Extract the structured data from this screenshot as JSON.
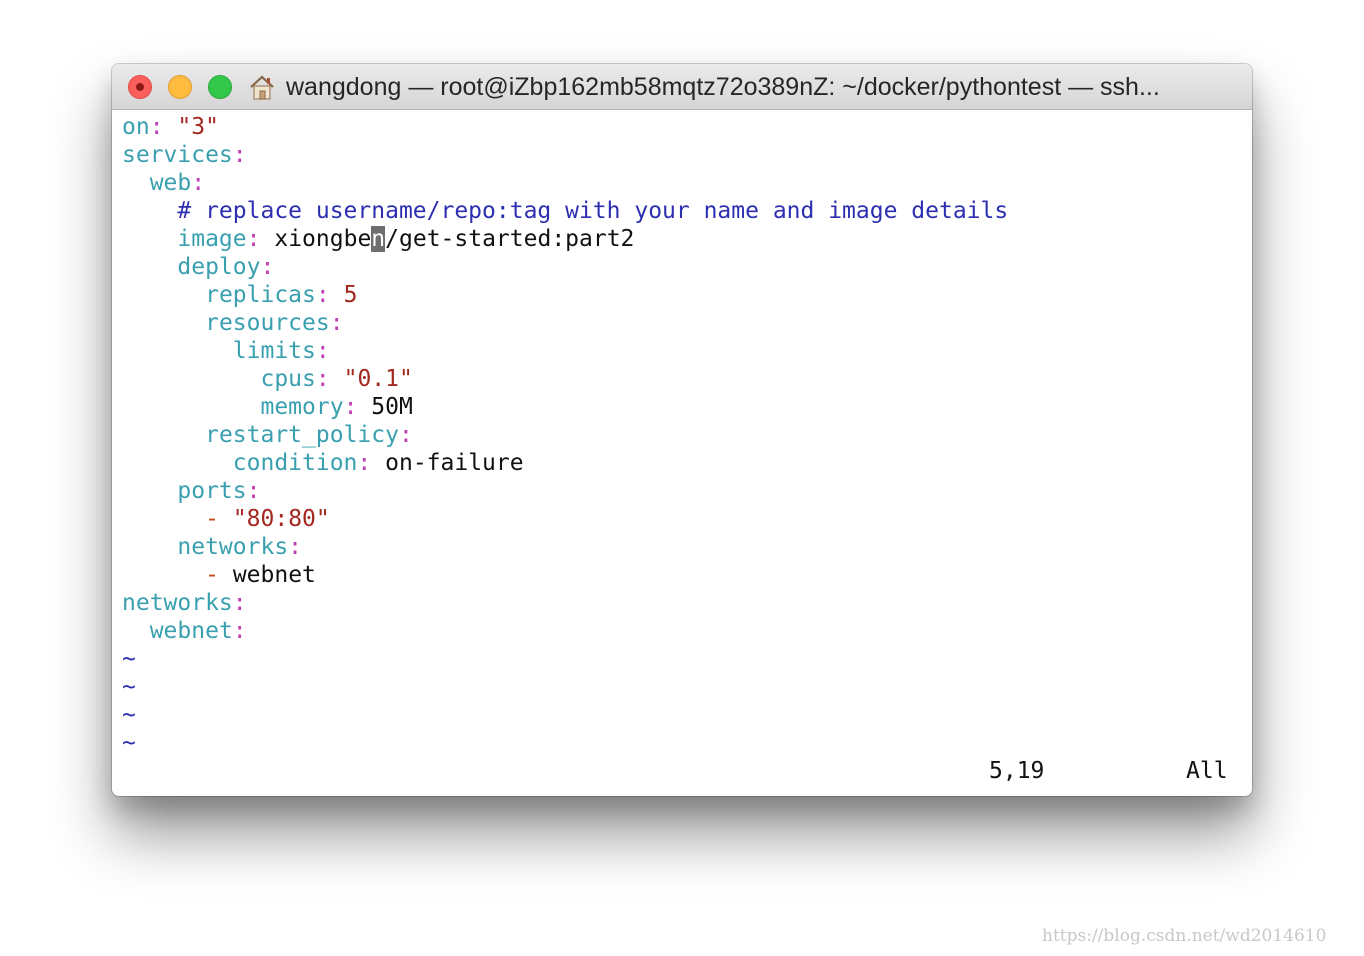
{
  "window": {
    "title": "wangdong — root@iZbp162mb58mqtz72o389nZ: ~/docker/pythontest — ssh...",
    "title_icon": "home-icon",
    "traffic_lights": [
      "close",
      "minimize",
      "zoom"
    ],
    "colors": {
      "close": "#fc605c",
      "minimize": "#fdbc40",
      "zoom": "#34c84a"
    }
  },
  "editor": {
    "lines": {
      "l1": {
        "key": "on",
        "colon": ":",
        "value": "\"3\""
      },
      "l2": {
        "key": "services",
        "colon": ":"
      },
      "l3": {
        "key": "web",
        "colon": ":"
      },
      "l4": {
        "comment": "# replace username/repo:tag with your name and image details"
      },
      "l5": {
        "key": "image",
        "colon": ":",
        "value_before_cursor": "xiongbe",
        "cursor_char": "n",
        "value_after_cursor": "/get-started:part2"
      },
      "l6": {
        "key": "deploy",
        "colon": ":"
      },
      "l7": {
        "key": "replicas",
        "colon": ":",
        "value": "5"
      },
      "l8": {
        "key": "resources",
        "colon": ":"
      },
      "l9": {
        "key": "limits",
        "colon": ":"
      },
      "l10": {
        "key": "cpus",
        "colon": ":",
        "value": "\"0.1\""
      },
      "l11": {
        "key": "memory",
        "colon": ":",
        "value": "50M"
      },
      "l12": {
        "key": "restart_policy",
        "colon": ":"
      },
      "l13": {
        "key": "condition",
        "colon": ":",
        "value": "on-failure"
      },
      "l14": {
        "key": "ports",
        "colon": ":"
      },
      "l15": {
        "dash": "-",
        "value": "\"80:80\""
      },
      "l16": {
        "key": "networks",
        "colon": ":"
      },
      "l17": {
        "dash": "-",
        "value": "webnet"
      },
      "l18": {
        "key": "networks",
        "colon": ":"
      },
      "l19": {
        "key": "webnet",
        "colon": ":"
      }
    },
    "tilde": "~",
    "status": {
      "position": "5,19",
      "scroll": "All"
    }
  },
  "watermark": "https://blog.csdn.net/wd2014610"
}
